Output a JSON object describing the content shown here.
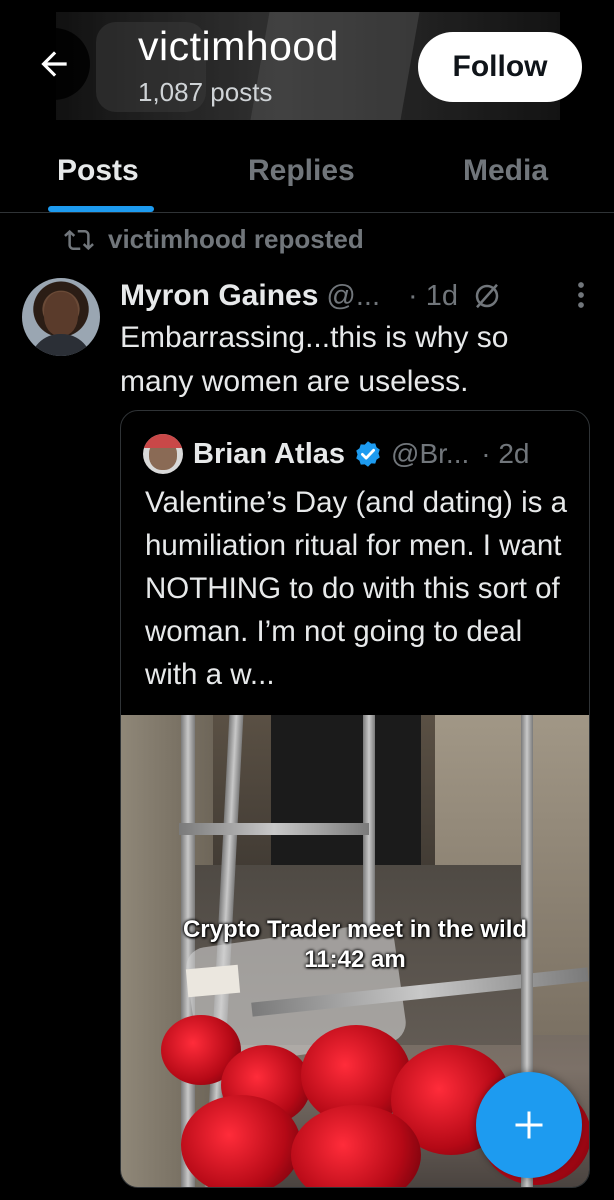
{
  "header": {
    "title": "victimhood",
    "subtitle": "1,087 posts",
    "follow_label": "Follow"
  },
  "tabs": [
    {
      "label": "Posts",
      "active": true
    },
    {
      "label": "Replies",
      "active": false
    },
    {
      "label": "Media",
      "active": false
    }
  ],
  "post": {
    "repost_label": "victimhood reposted",
    "author_name": "Myron Gaines",
    "author_handle": "@...",
    "time": "· 1d",
    "text": "Embarrassing...this is why so many women are useless.",
    "quote": {
      "author_name": "Brian Atlas",
      "author_handle": "@Br...",
      "time": "· 2d",
      "text": "Valentine’s Day (and dating) is a humiliation ritual for men. I want NOTHING to do with this sort of woman. I’m not going to deal with a w...",
      "media_caption_line1": "Crypto Trader meet in the wild",
      "media_caption_line2": "11:42 am"
    }
  },
  "icons": {
    "back": "back-arrow-icon",
    "repost": "repost-icon",
    "grok": "grok-icon",
    "more": "more-vertical-icon",
    "verified": "verified-badge-icon",
    "compose": "plus-icon"
  },
  "colors": {
    "accent": "#1d9bf0",
    "background": "#000000",
    "text_primary": "#e7e9ea",
    "text_secondary": "#71767b",
    "follow_button_bg": "#ffffff"
  }
}
